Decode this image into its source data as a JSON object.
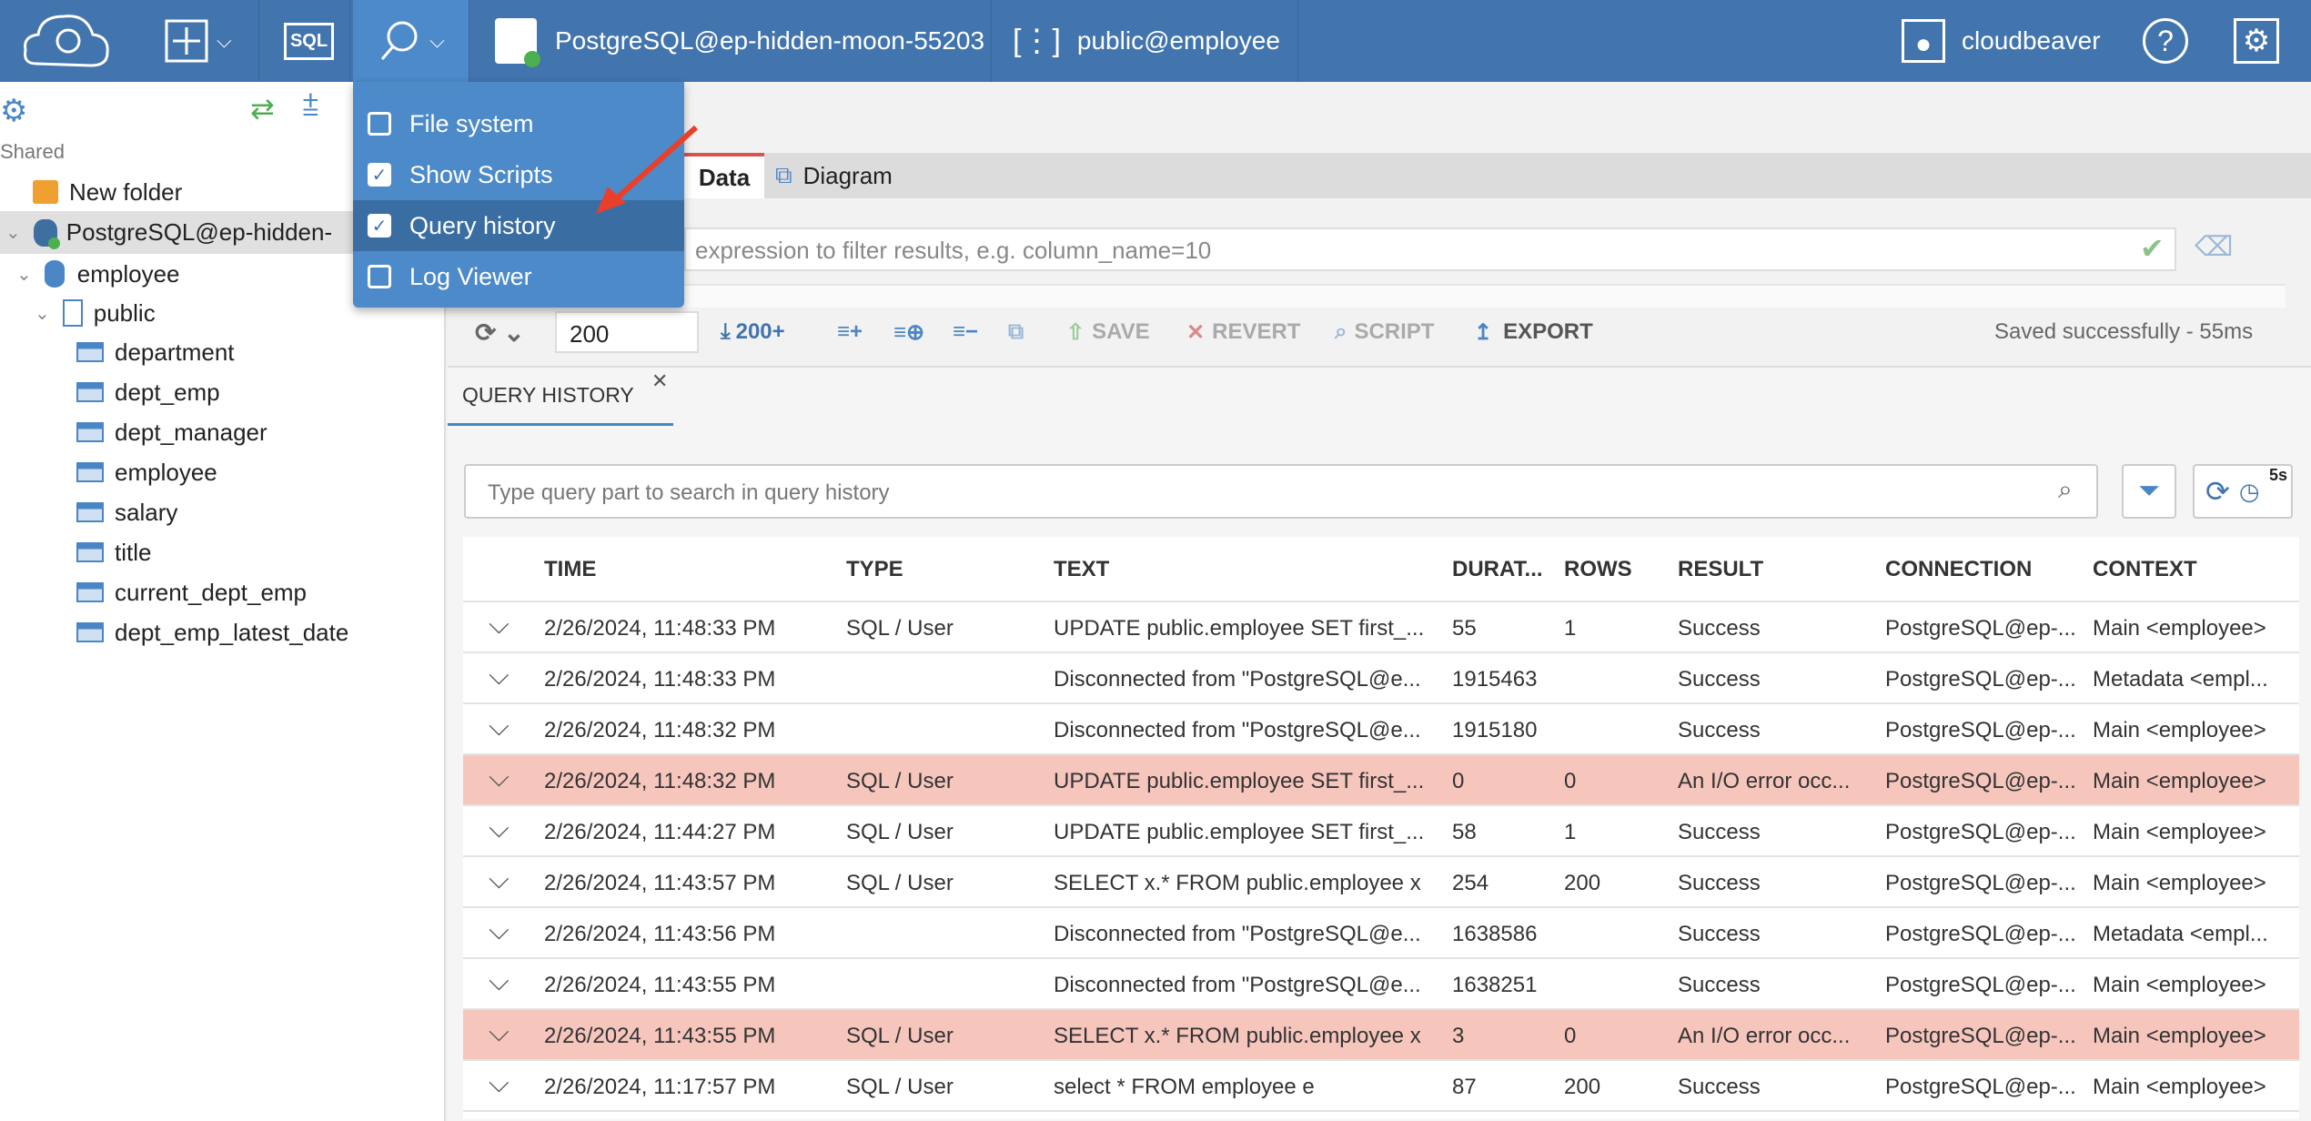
{
  "topbar": {
    "connection": "PostgreSQL@ep-hidden-moon-55203",
    "schema": "public@employee",
    "user": "cloudbeaver",
    "sql_label": "SQL"
  },
  "menu": {
    "items": [
      {
        "label": "File system",
        "checked": false
      },
      {
        "label": "Show Scripts",
        "checked": true
      },
      {
        "label": "Query history",
        "checked": true
      },
      {
        "label": "Log Viewer",
        "checked": false
      }
    ]
  },
  "sidebar": {
    "section": "Shared",
    "new_folder": "New folder",
    "connection": "PostgreSQL@ep-hidden-",
    "database": "employee",
    "schema": "public",
    "tables": [
      "department",
      "dept_emp",
      "dept_manager",
      "employee",
      "salary",
      "title"
    ],
    "views": [
      "current_dept_emp",
      "dept_emp_latest_date"
    ]
  },
  "editor": {
    "tabs": {
      "data": "Data",
      "diagram": "Diagram"
    },
    "filter_placeholder": "expression to filter results, e.g. column_name=10",
    "toolbar": {
      "fetch_size": "200",
      "fetch_more": "200+",
      "save": "SAVE",
      "revert": "REVERT",
      "script": "SCRIPT",
      "export": "EXPORT",
      "status": "Saved successfully - 55ms"
    }
  },
  "history": {
    "tab": "QUERY HISTORY",
    "search_placeholder": "Type query part to search in query history",
    "refresh_interval": "5s",
    "columns": [
      "TIME",
      "TYPE",
      "TEXT",
      "DURAT...",
      "ROWS",
      "RESULT",
      "CONNECTION",
      "CONTEXT"
    ],
    "rows": [
      [
        "2/26/2024, 11:48:33 PM",
        "SQL / User",
        "UPDATE public.employee SET first_...",
        "55",
        "1",
        "Success",
        "PostgreSQL@ep-...",
        "Main <employee>"
      ],
      [
        "2/26/2024, 11:48:33 PM",
        "",
        "Disconnected from \"PostgreSQL@e...",
        "1915463",
        "",
        "Success",
        "PostgreSQL@ep-...",
        "Metadata <empl..."
      ],
      [
        "2/26/2024, 11:48:32 PM",
        "",
        "Disconnected from \"PostgreSQL@e...",
        "1915180",
        "",
        "Success",
        "PostgreSQL@ep-...",
        "Main <employee>"
      ],
      [
        "2/26/2024, 11:48:32 PM",
        "SQL / User",
        "UPDATE public.employee SET first_...",
        "0",
        "0",
        "An I/O error occ...",
        "PostgreSQL@ep-...",
        "Main <employee>"
      ],
      [
        "2/26/2024, 11:44:27 PM",
        "SQL / User",
        "UPDATE public.employee SET first_...",
        "58",
        "1",
        "Success",
        "PostgreSQL@ep-...",
        "Main <employee>"
      ],
      [
        "2/26/2024, 11:43:57 PM",
        "SQL / User",
        "SELECT x.* FROM public.employee x",
        "254",
        "200",
        "Success",
        "PostgreSQL@ep-...",
        "Main <employee>"
      ],
      [
        "2/26/2024, 11:43:56 PM",
        "",
        "Disconnected from \"PostgreSQL@e...",
        "1638586",
        "",
        "Success",
        "PostgreSQL@ep-...",
        "Metadata <empl..."
      ],
      [
        "2/26/2024, 11:43:55 PM",
        "",
        "Disconnected from \"PostgreSQL@e...",
        "1638251",
        "",
        "Success",
        "PostgreSQL@ep-...",
        "Main <employee>"
      ],
      [
        "2/26/2024, 11:43:55 PM",
        "SQL / User",
        "SELECT x.* FROM public.employee x",
        "3",
        "0",
        "An I/O error occ...",
        "PostgreSQL@ep-...",
        "Main <employee>"
      ],
      [
        "2/26/2024, 11:17:57 PM",
        "SQL / User",
        "select * FROM employee e",
        "87",
        "200",
        "Success",
        "PostgreSQL@ep-...",
        "Main <employee>"
      ]
    ],
    "error_color": "#f6c6bd"
  }
}
